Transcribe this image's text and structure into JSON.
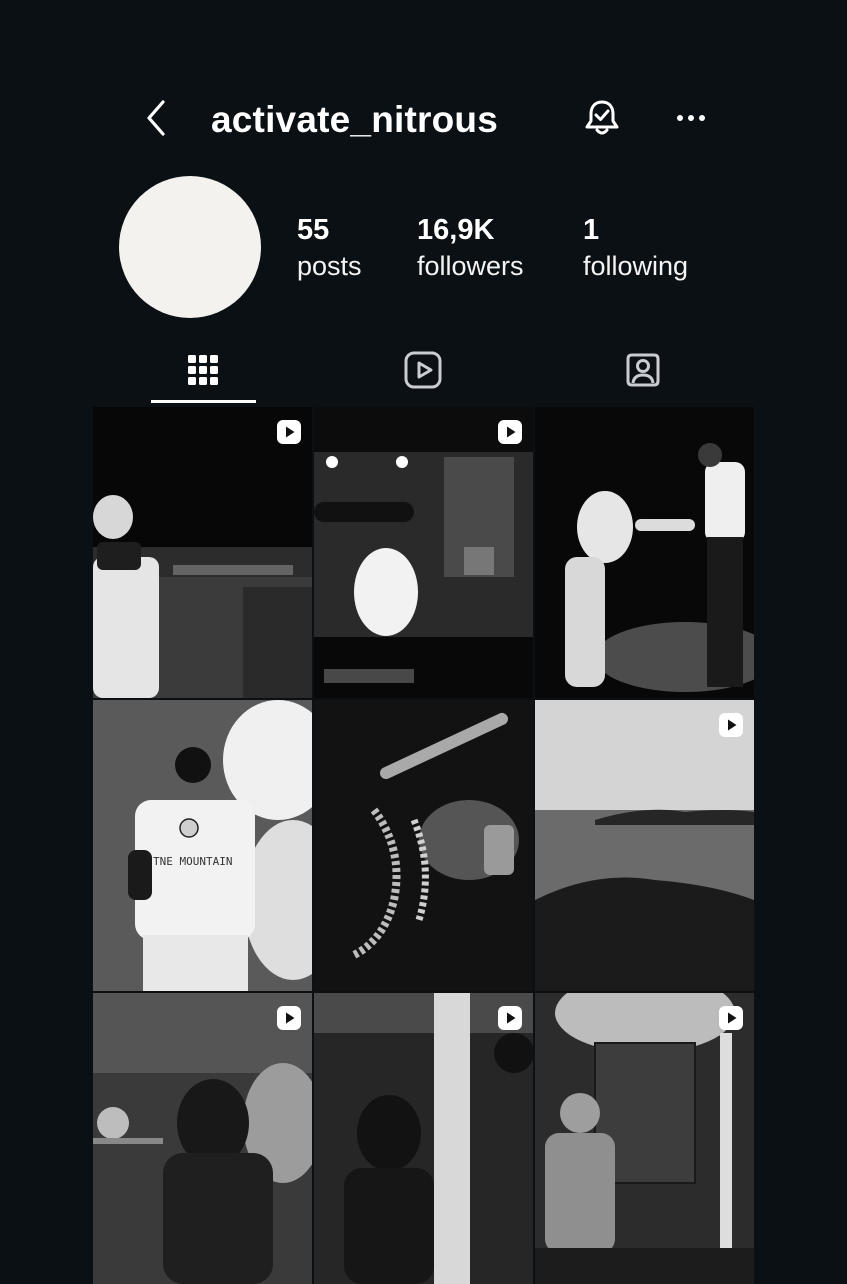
{
  "header": {
    "username": "activate_nitrous",
    "back_icon": "chevron-left-icon",
    "notification_icon": "bell-check-icon",
    "more_icon": "more-horizontal-icon"
  },
  "profile": {
    "avatar_color": "#f3f2ef",
    "stats": {
      "posts": {
        "value": "55",
        "label": "posts"
      },
      "followers": {
        "value": "16,9K",
        "label": "followers"
      },
      "following": {
        "value": "1",
        "label": "following"
      }
    }
  },
  "tabs": [
    {
      "name": "posts",
      "icon": "grid-icon",
      "selected": true
    },
    {
      "name": "reels",
      "icon": "reels-play-icon",
      "selected": false
    },
    {
      "name": "tagged",
      "icon": "tagged-person-icon",
      "selected": false
    }
  ],
  "theme": {
    "background": "#0b1014",
    "text": "#ffffff",
    "indicator": "#ffffff"
  },
  "grid": {
    "posts": [
      {
        "description_icon": "photo-thumbnail",
        "is_reel": true,
        "shirt_text": ""
      },
      {
        "description_icon": "photo-thumbnail",
        "is_reel": true,
        "shirt_text": ""
      },
      {
        "description_icon": "photo-thumbnail",
        "is_reel": false,
        "shirt_text": ""
      },
      {
        "description_icon": "photo-thumbnail",
        "is_reel": false,
        "shirt_text": "TNE MOUNTAIN"
      },
      {
        "description_icon": "photo-thumbnail",
        "is_reel": false,
        "shirt_text": ""
      },
      {
        "description_icon": "photo-thumbnail",
        "is_reel": true,
        "shirt_text": ""
      },
      {
        "description_icon": "photo-thumbnail",
        "is_reel": true,
        "shirt_text": ""
      },
      {
        "description_icon": "photo-thumbnail",
        "is_reel": true,
        "shirt_text": ""
      },
      {
        "description_icon": "photo-thumbnail",
        "is_reel": true,
        "shirt_text": ""
      }
    ]
  }
}
